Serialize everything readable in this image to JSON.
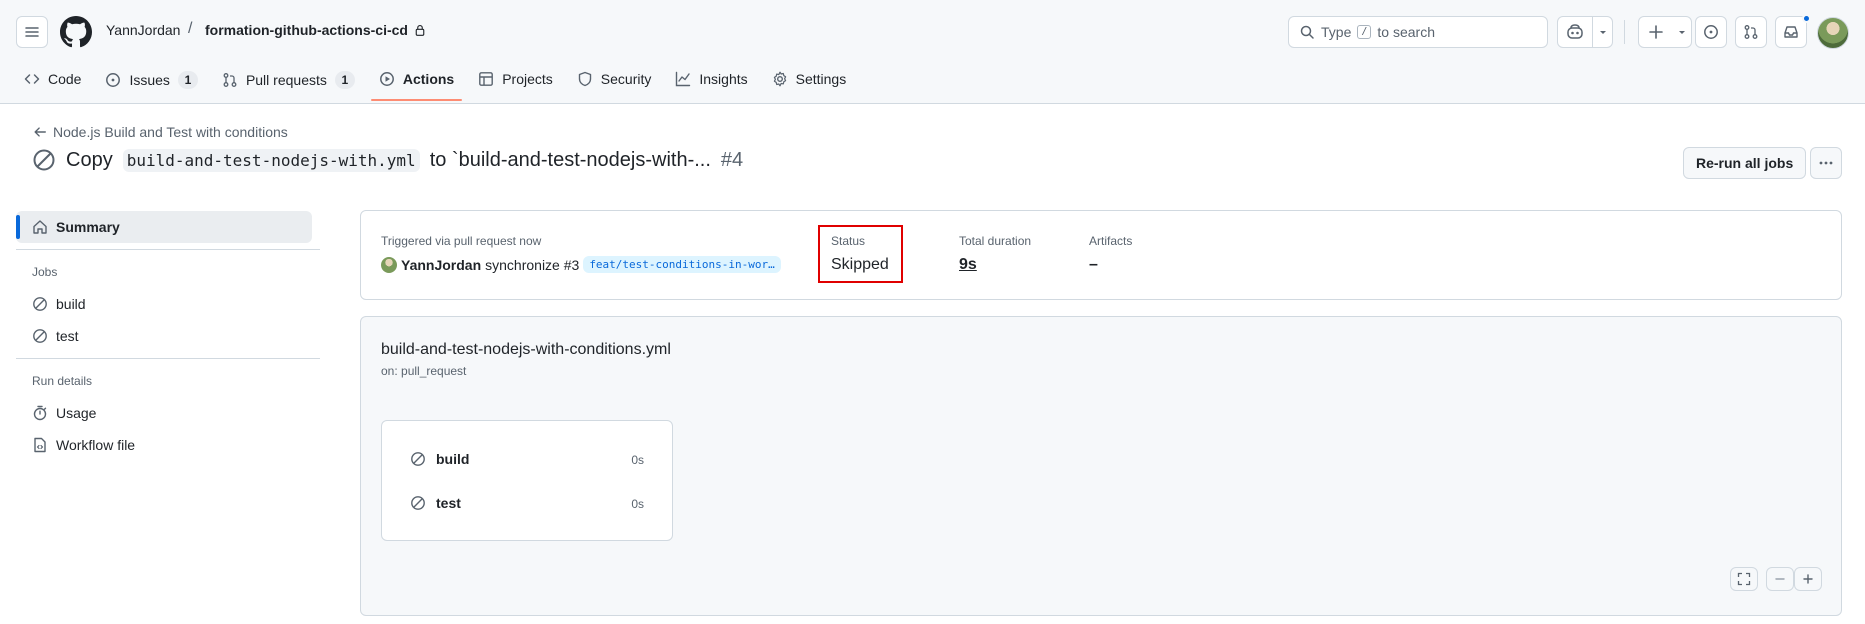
{
  "header": {
    "owner": "YannJordan",
    "separator": "/",
    "repo": "formation-github-actions-ci-cd",
    "search_placeholder": "Type",
    "search_key": "/",
    "search_suffix": "to search"
  },
  "nav": {
    "tabs": [
      {
        "label": "Code",
        "icon": "code-icon"
      },
      {
        "label": "Issues",
        "icon": "issue-icon",
        "count": "1"
      },
      {
        "label": "Pull requests",
        "icon": "pull-request-icon",
        "count": "1"
      },
      {
        "label": "Actions",
        "icon": "play-icon",
        "active": true
      },
      {
        "label": "Projects",
        "icon": "table-icon"
      },
      {
        "label": "Security",
        "icon": "shield-icon"
      },
      {
        "label": "Insights",
        "icon": "graph-icon"
      },
      {
        "label": "Settings",
        "icon": "gear-icon"
      }
    ]
  },
  "run": {
    "back_label": "Node.js Build and Test with conditions",
    "title_prefix": "Copy",
    "title_code": "build-and-test-nodejs-with.yml",
    "title_suffix": "to `build-and-test-nodejs-with-...",
    "run_number": "#4",
    "rerun_label": "Re-run all jobs"
  },
  "sidebar": {
    "summary": "Summary",
    "jobs_heading": "Jobs",
    "jobs": [
      "build",
      "test"
    ],
    "run_details_heading": "Run details",
    "usage": "Usage",
    "workflow_file": "Workflow file"
  },
  "summary": {
    "trigger_label": "Triggered via pull request now",
    "actor": "YannJordan",
    "action": "synchronize #3",
    "branch": "feat/test-conditions-in-wor…",
    "status_label": "Status",
    "status_value": "Skipped",
    "duration_label": "Total duration",
    "duration_value": "9s",
    "artifacts_label": "Artifacts",
    "artifacts_value": "–"
  },
  "workflow": {
    "file": "build-and-test-nodejs-with-conditions.yml",
    "on": "on: pull_request",
    "jobs": [
      {
        "name": "build",
        "duration": "0s"
      },
      {
        "name": "test",
        "duration": "0s"
      }
    ]
  },
  "colors": {
    "accent": "#0969da",
    "active_tab_underline": "#fd8c73",
    "highlight_box": "#e00000"
  }
}
